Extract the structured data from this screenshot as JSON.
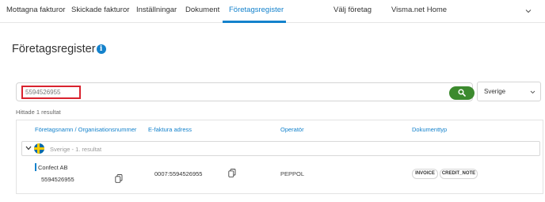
{
  "nav": {
    "items": [
      "Mottagna fakturor",
      "Skickade fakturor",
      "Inställningar",
      "Dokument",
      "Företagsregister",
      "Välj företag",
      "Visma.net Home"
    ],
    "active_index": 4
  },
  "page": {
    "title": "Företagsregister",
    "info_icon": "i"
  },
  "search": {
    "value": "5594526955",
    "button_icon": "search-icon"
  },
  "country_select": {
    "selected": "Sverige"
  },
  "results": {
    "count_text": "Hittade 1 resultat",
    "columns": [
      "Företagsnamn / Organisationsnummer",
      "E-faktura adress",
      "Operatör",
      "Dokumenttyp"
    ],
    "group": {
      "label": "Sverige - 1. resultat",
      "flag": "sweden-flag"
    },
    "rows": [
      {
        "company": "Confect AB",
        "org_number": "5594526955",
        "efaktura": "0007:5594526955",
        "operator": "PEPPOL",
        "doc_types": [
          "INVOICE",
          "CREDIT_NOTE"
        ]
      }
    ]
  },
  "colors": {
    "accent": "#1482cc",
    "search_button": "#3c8a2e",
    "highlight_border": "#d9232f"
  }
}
